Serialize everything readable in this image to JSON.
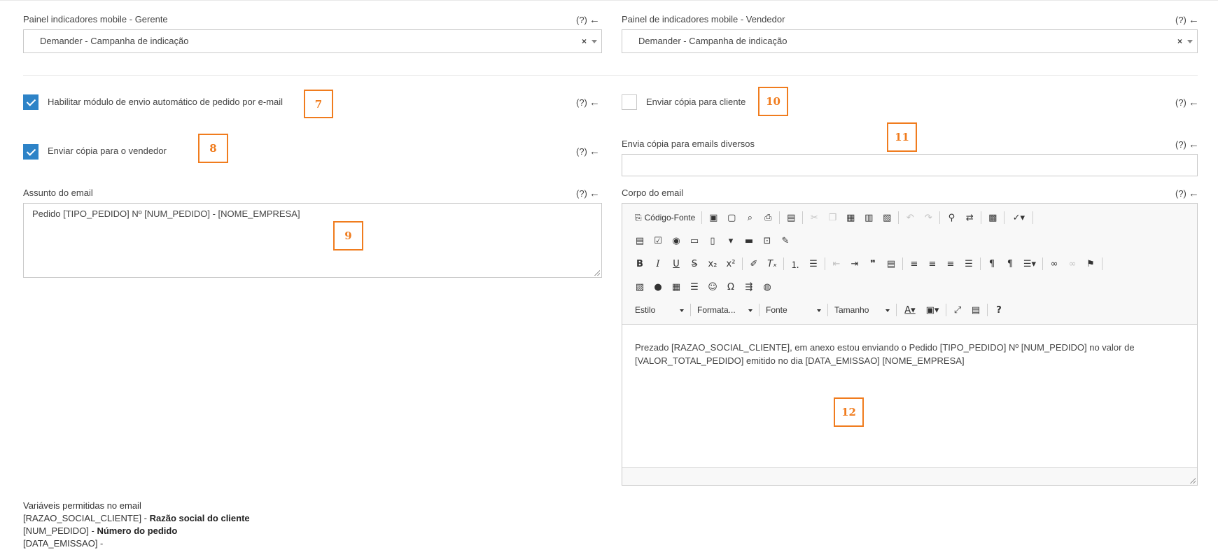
{
  "mobile_manager": {
    "label": "Painel indicadores mobile - Gerente",
    "help": "(?)",
    "arrow": "←",
    "value": "Demander - Campanha de indicação",
    "clear": "×"
  },
  "mobile_seller": {
    "label": "Painel de indicadores mobile - Vendedor",
    "help": "(?)",
    "arrow": "←",
    "value": "Demander - Campanha de indicação",
    "clear": "×"
  },
  "enable_email": {
    "label": "Habilitar módulo de envio automático de pedido por e-mail",
    "checked": true,
    "help": "(?)",
    "arrow": "←",
    "marker": "7"
  },
  "copy_client": {
    "label": "Enviar cópia para cliente",
    "checked": false,
    "help": "(?)",
    "arrow": "←",
    "marker": "10"
  },
  "copy_seller": {
    "label": "Enviar cópia para o vendedor",
    "checked": true,
    "help": "(?)",
    "arrow": "←",
    "marker": "8"
  },
  "misc_emails": {
    "label": "Envia cópia para emails diversos",
    "help": "(?)",
    "arrow": "←",
    "marker": "11",
    "value": ""
  },
  "subject": {
    "label": "Assunto do email",
    "help": "(?)",
    "arrow": "←",
    "value": "Pedido [TIPO_PEDIDO] Nº [NUM_PEDIDO] - [NOME_EMPRESA]",
    "marker": "9"
  },
  "body": {
    "label": "Corpo do email",
    "help": "(?)",
    "arrow": "←",
    "marker": "12",
    "source_label": "Código-Fonte",
    "combos": [
      "Estilo",
      "Formata...",
      "Fonte",
      "Tamanho"
    ],
    "line1": "Prezado [RAZAO_SOCIAL_CLIENTE], em anexo estou enviando o Pedido [TIPO_PEDIDO] Nº [NUM_PEDIDO] no valor de",
    "line2": "[VALOR_TOTAL_PEDIDO] emitido no dia [DATA_EMISSAO] [NOME_EMPRESA]"
  },
  "variables": {
    "title": "Variáveis permitidas no email",
    "items": [
      {
        "key": "[RAZAO_SOCIAL_CLIENTE] - ",
        "desc": "Razão social do cliente"
      },
      {
        "key": "[NUM_PEDIDO] - ",
        "desc": "Número do pedido"
      },
      {
        "key": "[DATA_EMISSAO] - ",
        "desc": ""
      }
    ]
  },
  "colors": {
    "accent": "#2d83c7",
    "marker": "#f07c1e"
  }
}
